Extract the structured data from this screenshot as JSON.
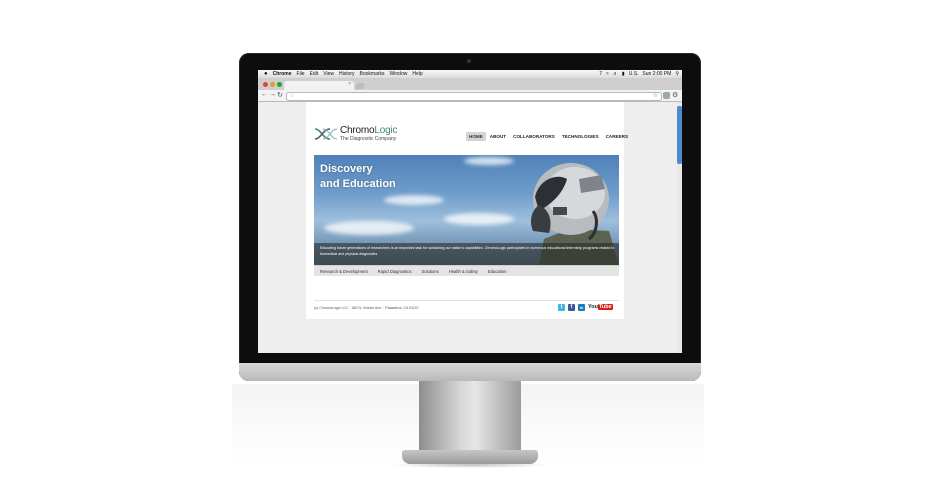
{
  "menubar": {
    "apple": "",
    "app": "Chrome",
    "items": [
      "File",
      "Edit",
      "View",
      "History",
      "Bookmarks",
      "Window",
      "Help"
    ],
    "status": "7",
    "region": "U.S.",
    "clock": "Sun 2:00 PM"
  },
  "site": {
    "brand_prefix": "Chromo",
    "brand_suffix": "Logic",
    "tagline": "The Diagnostic Company",
    "nav": [
      "HOME",
      "ABOUT",
      "COLLABORATORS",
      "TECHNOLOGIES",
      "CAREERS"
    ],
    "hero": {
      "title_line1": "Discovery",
      "title_line2": "and Education",
      "caption": "Educating future generations of researchers is an important task for sustaining our nation's capabilities. ChromoLogic participates in numerous educational internship programs related to biomedical and physical diagnostics."
    },
    "subnav": [
      "Research & Development",
      "Rapid Diagnostics",
      "Solutions",
      "Health & Safety",
      "Education"
    ],
    "footer": "(c) ChromoLogic LLC · 180 N. Vinedo Ave. · Pasadena, CA 91107",
    "social": {
      "twitter": "t",
      "facebook": "f",
      "linkedin": "in",
      "youtube_a": "You",
      "youtube_b": "Tube"
    }
  }
}
